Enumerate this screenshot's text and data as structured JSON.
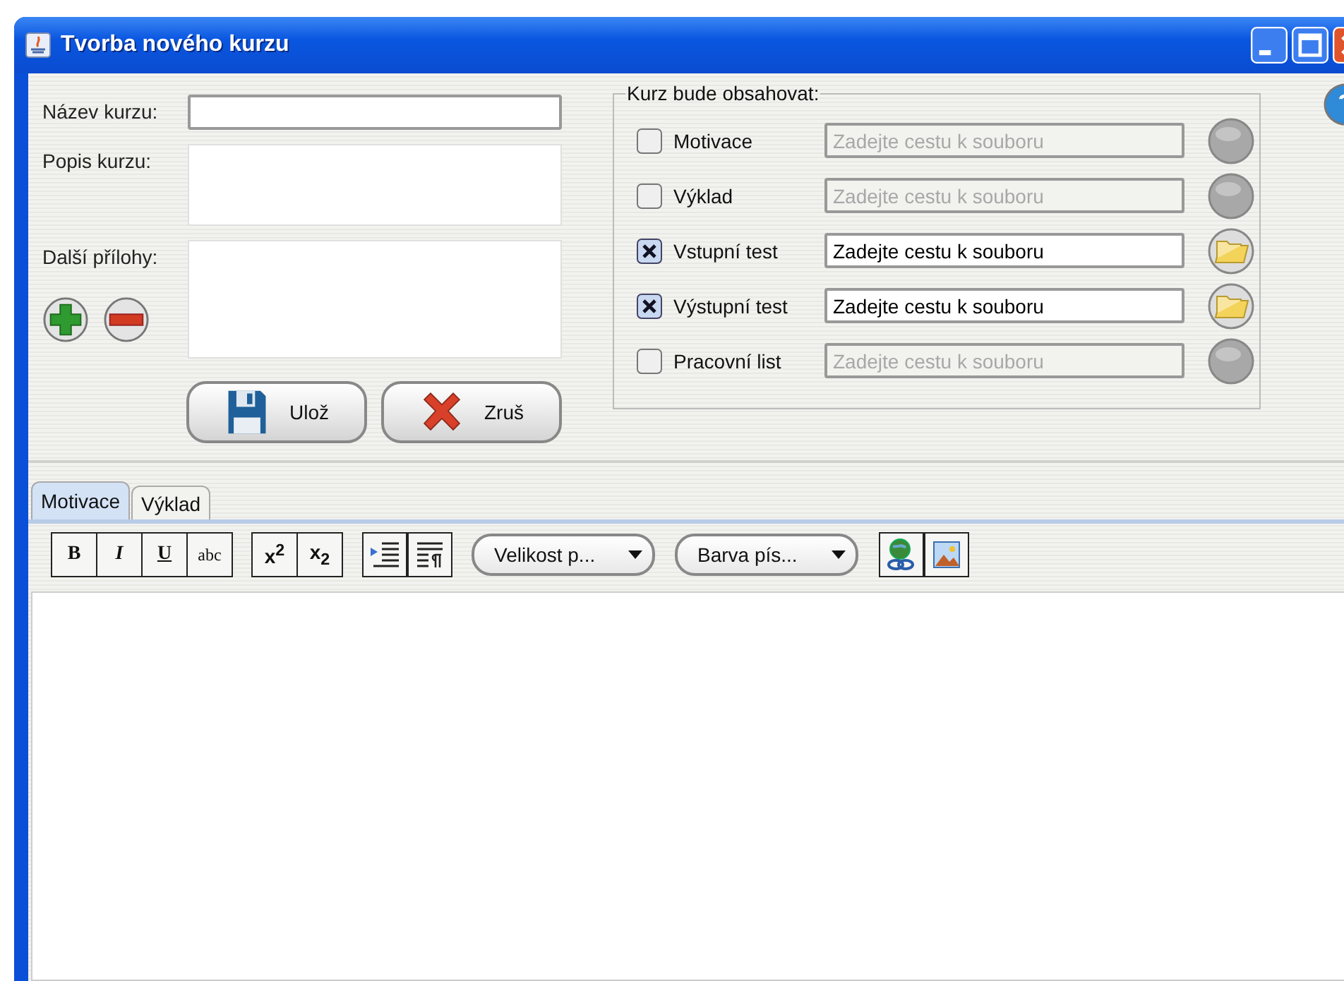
{
  "window": {
    "title": "Tvorba nového kurzu"
  },
  "form": {
    "name_label": "Název kurzu:",
    "description_label": "Popis kurzu:",
    "attachments_label": "Další přílohy:"
  },
  "buttons": [
    {
      "kind": "save",
      "label": "Ulož"
    },
    {
      "kind": "cancel",
      "label": "Zruš"
    }
  ],
  "contents": {
    "legend": "Kurz bude obsahovat:",
    "rows": [
      {
        "label": "Motivace",
        "checked": false,
        "path": "Zadejte cestu k souboru"
      },
      {
        "label": "Výklad",
        "checked": false,
        "path": "Zadejte cestu k souboru"
      },
      {
        "label": "Vstupní test",
        "checked": true,
        "path": "Zadejte cestu k souboru"
      },
      {
        "label": "Výstupní test",
        "checked": true,
        "path": "Zadejte cestu k souboru"
      },
      {
        "label": "Pracovní list",
        "checked": false,
        "path": "Zadejte cestu k souboru"
      }
    ]
  },
  "tabs": [
    {
      "label": "Motivace",
      "selected": true
    },
    {
      "label": "Výklad",
      "selected": false
    }
  ],
  "toolbar": [
    [
      {
        "kind": "bold",
        "label": "B"
      },
      {
        "kind": "italic",
        "label": "I"
      },
      {
        "kind": "underline",
        "label": "U"
      },
      {
        "kind": "strike",
        "label": "abc"
      }
    ],
    [
      {
        "kind": "sup",
        "label": "x$^{2}$"
      },
      {
        "kind": "sub",
        "label": "x$_{2}$"
      }
    ],
    [
      {
        "kind": "indent"
      },
      {
        "kind": "paragraph"
      }
    ],
    [
      {
        "kind": "dropdown",
        "label": "Velikost p..."
      }
    ],
    [
      {
        "kind": "dropdown",
        "label": "Barva pís..."
      }
    ],
    [
      {
        "kind": "link"
      },
      {
        "kind": "image"
      }
    ]
  ]
}
